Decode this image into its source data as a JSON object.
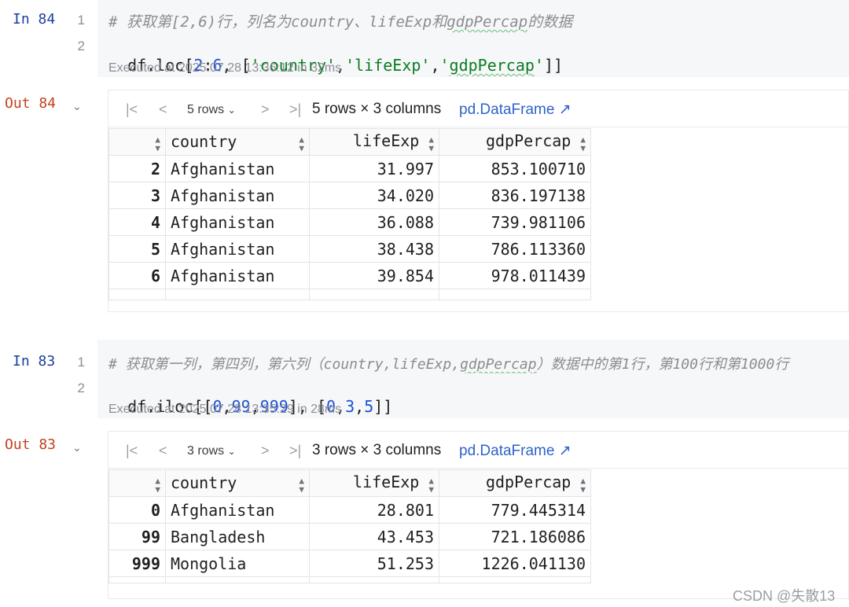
{
  "cells": [
    {
      "in_label": "In 84",
      "line_numbers": [
        "1",
        "2"
      ],
      "comment_line": "# 获取第[2,6)行，列名为country、lifeExp和gdpPercap的数据",
      "code_line": "df.loc[2:6, ['country','lifeExp','gdpPercap']]",
      "executed": "Executed at 2025.07.28 13:36:12 in 32ms",
      "out_label": "Out 84",
      "toolbar": {
        "first_icon": "|<",
        "prev_icon": "<",
        "rows_select": "5 rows",
        "next_icon": ">",
        "last_icon": ">|",
        "info": "5 rows × 3 columns",
        "link": "pd.DataFrame ↗"
      },
      "columns": [
        "country",
        "lifeExp",
        "gdpPercap"
      ],
      "rows": [
        {
          "index": "2",
          "country": "Afghanistan",
          "lifeExp": "31.997",
          "gdpPercap": "853.100710"
        },
        {
          "index": "3",
          "country": "Afghanistan",
          "lifeExp": "34.020",
          "gdpPercap": "836.197138"
        },
        {
          "index": "4",
          "country": "Afghanistan",
          "lifeExp": "36.088",
          "gdpPercap": "739.981106"
        },
        {
          "index": "5",
          "country": "Afghanistan",
          "lifeExp": "38.438",
          "gdpPercap": "786.113360"
        },
        {
          "index": "6",
          "country": "Afghanistan",
          "lifeExp": "39.854",
          "gdpPercap": "978.011439"
        }
      ]
    },
    {
      "in_label": "In 83",
      "line_numbers": [
        "1",
        "2"
      ],
      "comment_line": "# 获取第一列，第四列，第六列（country,lifeExp,gdpPercap）数据中的第1行，第100行和第1000行",
      "code_line": "df.iloc[[0,99,999], [0,3,5]]",
      "executed": "Executed at 2025.07.28 13:35:29 in 28ms",
      "out_label": "Out 83",
      "toolbar": {
        "first_icon": "|<",
        "prev_icon": "<",
        "rows_select": "3 rows",
        "next_icon": ">",
        "last_icon": ">|",
        "info": "3 rows × 3 columns",
        "link": "pd.DataFrame ↗"
      },
      "columns": [
        "country",
        "lifeExp",
        "gdpPercap"
      ],
      "rows": [
        {
          "index": "0",
          "country": "Afghanistan",
          "lifeExp": "28.801",
          "gdpPercap": "779.445314"
        },
        {
          "index": "99",
          "country": "Bangladesh",
          "lifeExp": "43.453",
          "gdpPercap": "721.186086"
        },
        {
          "index": "999",
          "country": "Mongolia",
          "lifeExp": "51.253",
          "gdpPercap": "1226.041130"
        }
      ]
    }
  ],
  "watermark": "CSDN @失散13",
  "colors": {
    "in_label": "#1c3fa0",
    "out_label": "#c5401f",
    "string": "#0a7d1f",
    "number": "#1c4fd8",
    "link": "#2f62c9"
  }
}
